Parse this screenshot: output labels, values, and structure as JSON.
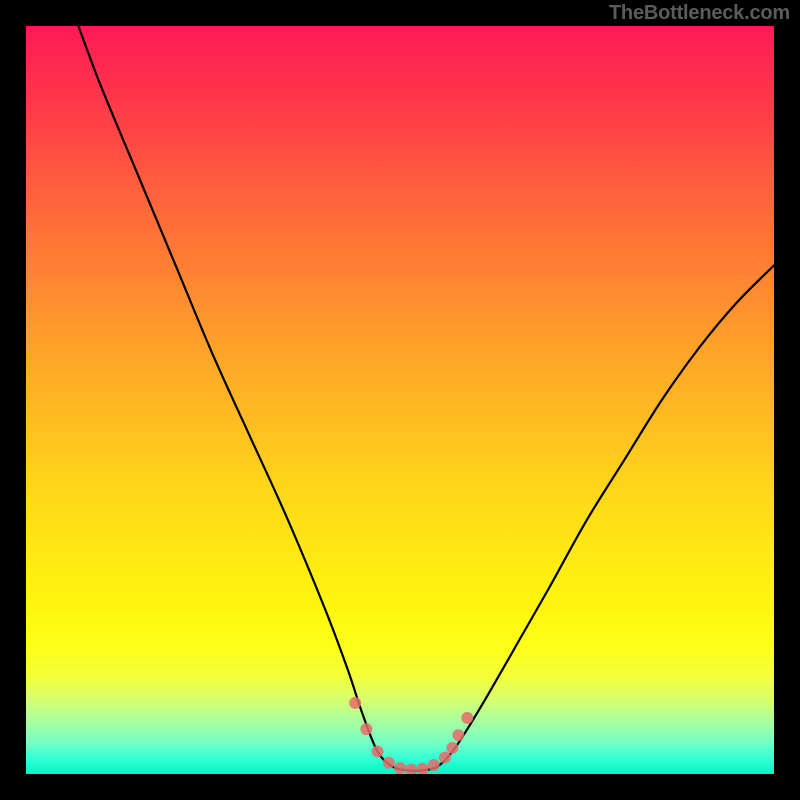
{
  "watermark": "TheBottleneck.com",
  "chart_data": {
    "type": "line",
    "title": "",
    "xlabel": "",
    "ylabel": "",
    "xlim": [
      0,
      100
    ],
    "ylim": [
      0,
      100
    ],
    "grid": false,
    "legend": false,
    "curve_description": "V-shaped bottleneck curve with flat bottom near y=0 between x≈47 and x≈57",
    "series": [
      {
        "name": "bottleneck-curve",
        "color": "#000000",
        "x": [
          7,
          10,
          15,
          20,
          25,
          30,
          35,
          40,
          43,
          45,
          47,
          49,
          51,
          53,
          55,
          57,
          59,
          62,
          66,
          70,
          75,
          80,
          85,
          90,
          95,
          100
        ],
        "y": [
          100,
          92,
          80,
          68,
          56,
          45,
          34,
          22,
          14,
          8,
          3,
          1,
          0.5,
          0.5,
          1,
          3,
          6,
          11,
          18,
          25,
          34,
          42,
          50,
          57,
          63,
          68
        ]
      }
    ],
    "marker_points": {
      "name": "highlight-dots",
      "color": "#e86b6b",
      "x": [
        44.0,
        45.5,
        47.0,
        48.5,
        50.0,
        51.5,
        53.0,
        54.5,
        56.0,
        57.0,
        57.8,
        59.0
      ],
      "y": [
        9.5,
        6.0,
        3.0,
        1.5,
        0.8,
        0.6,
        0.7,
        1.2,
        2.2,
        3.5,
        5.2,
        7.5
      ]
    },
    "background_gradient": {
      "direction": "top-to-bottom",
      "stops": [
        {
          "pos": 0.0,
          "color": "#ff1a55"
        },
        {
          "pos": 0.5,
          "color": "#ffbd21"
        },
        {
          "pos": 0.8,
          "color": "#fff60f"
        },
        {
          "pos": 1.0,
          "color": "#00f7c3"
        }
      ]
    }
  }
}
